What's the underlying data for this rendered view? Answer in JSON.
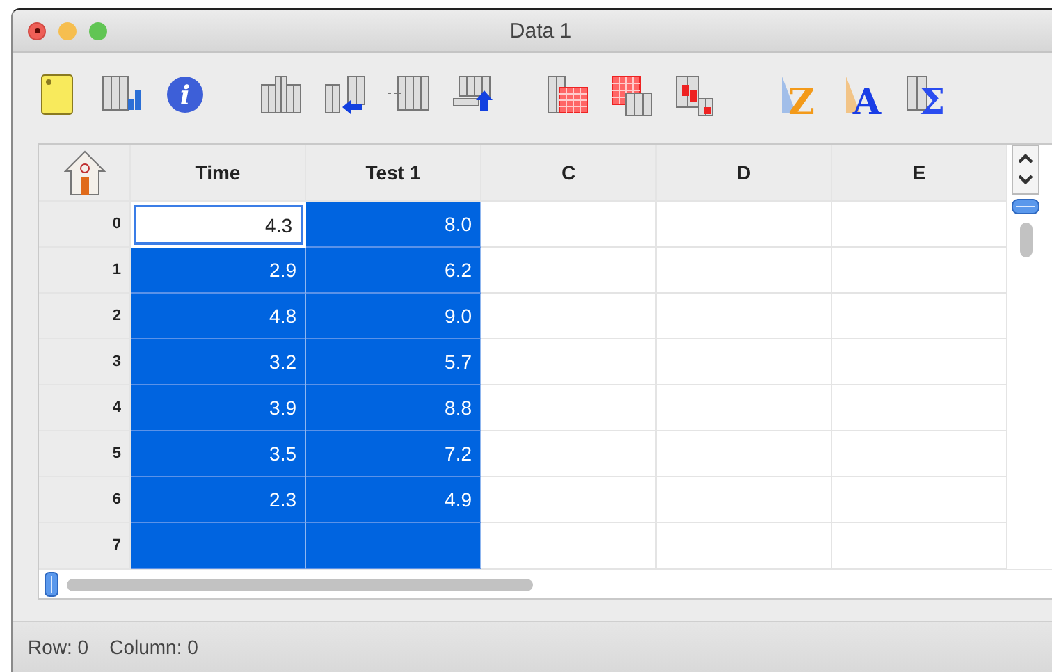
{
  "window": {
    "title": "Data 1"
  },
  "toolbar": {
    "glyphs": [
      "i",
      "Z",
      "A",
      "Σ"
    ]
  },
  "table": {
    "columns": [
      "Time",
      "Test 1",
      "C",
      "D",
      "E"
    ],
    "rows": [
      {
        "label": "0",
        "cells": [
          {
            "value": "4.3",
            "selected": false,
            "current": true
          },
          {
            "value": "8.0",
            "selected": true,
            "current": false
          },
          {
            "selected": false,
            "current": false
          },
          {
            "selected": false,
            "current": false
          },
          {
            "selected": false,
            "current": false
          }
        ]
      },
      {
        "label": "1",
        "cells": [
          {
            "value": "2.9",
            "selected": true,
            "current": false
          },
          {
            "value": "6.2",
            "selected": true,
            "current": false
          },
          {
            "selected": false,
            "current": false
          },
          {
            "selected": false,
            "current": false
          },
          {
            "selected": false,
            "current": false
          }
        ]
      },
      {
        "label": "2",
        "cells": [
          {
            "value": "4.8",
            "selected": true,
            "current": false
          },
          {
            "value": "9.0",
            "selected": true,
            "current": false
          },
          {
            "selected": false,
            "current": false
          },
          {
            "selected": false,
            "current": false
          },
          {
            "selected": false,
            "current": false
          }
        ]
      },
      {
        "label": "3",
        "cells": [
          {
            "value": "3.2",
            "selected": true,
            "current": false
          },
          {
            "value": "5.7",
            "selected": true,
            "current": false
          },
          {
            "selected": false,
            "current": false
          },
          {
            "selected": false,
            "current": false
          },
          {
            "selected": false,
            "current": false
          }
        ]
      },
      {
        "label": "4",
        "cells": [
          {
            "value": "3.9",
            "selected": true,
            "current": false
          },
          {
            "value": "8.8",
            "selected": true,
            "current": false
          },
          {
            "selected": false,
            "current": false
          },
          {
            "selected": false,
            "current": false
          },
          {
            "selected": false,
            "current": false
          }
        ]
      },
      {
        "label": "5",
        "cells": [
          {
            "value": "3.5",
            "selected": true,
            "current": false
          },
          {
            "value": "7.2",
            "selected": true,
            "current": false
          },
          {
            "selected": false,
            "current": false
          },
          {
            "selected": false,
            "current": false
          },
          {
            "selected": false,
            "current": false
          }
        ]
      },
      {
        "label": "6",
        "cells": [
          {
            "value": "2.3",
            "selected": true,
            "current": false
          },
          {
            "value": "4.9",
            "selected": true,
            "current": false
          },
          {
            "selected": false,
            "current": false
          },
          {
            "selected": false,
            "current": false
          },
          {
            "selected": false,
            "current": false
          }
        ]
      },
      {
        "label": "7",
        "cells": [
          {
            "selected": true,
            "current": false
          },
          {
            "selected": true,
            "current": false
          },
          {
            "selected": false,
            "current": false
          },
          {
            "selected": false,
            "current": false
          },
          {
            "selected": false,
            "current": false
          }
        ]
      }
    ]
  },
  "status_bar": {
    "row": "Row: 0",
    "column": "Column: 0"
  }
}
